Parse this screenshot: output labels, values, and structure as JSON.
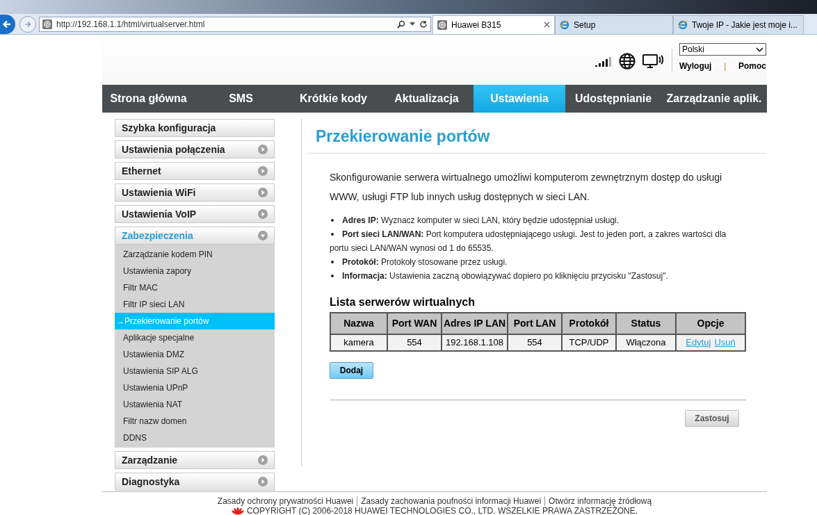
{
  "browser": {
    "address": "http://192.168.1.1/html/virtualserver.html",
    "tabs": [
      {
        "label": "Huawei B315",
        "selected": true,
        "kind": "site"
      },
      {
        "label": "Setup",
        "selected": false,
        "kind": "ie"
      },
      {
        "label": "Twoje IP - Jakie jest moje i...",
        "selected": false,
        "kind": "ie"
      }
    ]
  },
  "header": {
    "language": "Polski",
    "logout": "Wyloguj",
    "separator": "|",
    "help": "Pomoc"
  },
  "nav": [
    {
      "label": "Strona główna",
      "selected": false
    },
    {
      "label": "SMS",
      "selected": false
    },
    {
      "label": "Krótkie kody",
      "selected": false
    },
    {
      "label": "Aktualizacja",
      "selected": false
    },
    {
      "label": "Ustawienia",
      "selected": true
    },
    {
      "label": "Udostępnianie",
      "selected": false
    },
    {
      "label": "Zarządzanie aplik.",
      "selected": false
    }
  ],
  "sidebar": [
    {
      "label": "Szybka konfiguracja",
      "kind": "link",
      "expanded": false
    },
    {
      "label": "Ustawienia połączenia",
      "kind": "group",
      "expanded": false
    },
    {
      "label": "Ethernet",
      "kind": "group",
      "expanded": false
    },
    {
      "label": "Ustawienia WiFi",
      "kind": "group",
      "expanded": false
    },
    {
      "label": "Ustawienia VoIP",
      "kind": "group",
      "expanded": false
    },
    {
      "label": "Zabezpieczenia",
      "kind": "group",
      "expanded": true,
      "children": [
        {
          "label": "Zarządzanie kodem PIN",
          "selected": false
        },
        {
          "label": "Ustawienia zapory",
          "selected": false
        },
        {
          "label": "Filtr MAC",
          "selected": false
        },
        {
          "label": "Filtr IP sieci LAN",
          "selected": false
        },
        {
          "label": "Przekierowanie portów",
          "selected": true,
          "marker": "→"
        },
        {
          "label": "Aplikacje specjalne",
          "selected": false
        },
        {
          "label": "Ustawienia DMZ",
          "selected": false
        },
        {
          "label": "Ustawienia SIP ALG",
          "selected": false
        },
        {
          "label": "Ustawienia UPnP",
          "selected": false
        },
        {
          "label": "Ustawienia NAT",
          "selected": false
        },
        {
          "label": "Filtr nazw domen",
          "selected": false
        },
        {
          "label": "DDNS",
          "selected": false
        }
      ]
    },
    {
      "label": "Zarządzanie",
      "kind": "group",
      "expanded": false
    },
    {
      "label": "Diagnostyka",
      "kind": "group",
      "expanded": false
    }
  ],
  "content": {
    "title": "Przekierowanie portów",
    "intro": "Skonfigurowanie serwera wirtualnego umożliwi komputerom zewnętrznym dostęp do usługi WWW, usługi FTP lub innych usług dostępnych w sieci LAN.",
    "bullets": [
      "**Adres IP:** Wyznacz komputer w sieci LAN, który będzie udostępniał usługi.",
      "**Port sieci LAN/WAN:** Port komputera udostępniającego usługi. Jest to jeden port, a zakres wartości dla portu sieci LAN/WAN wynosi od 1 do 65535.",
      "**Protokół:** Protokoły stosowane przez usługi.",
      "**Informacja:** Ustawienia zaczną obowiązywać dopiero po kliknięciu przycisku \"Zastosuj\"."
    ],
    "table": {
      "title": "Lista serwerów wirtualnych",
      "columns": [
        "Nazwa",
        "Port WAN",
        "Adres IP LAN",
        "Port LAN",
        "Protokół",
        "Status",
        "Opcje"
      ],
      "rows": [
        {
          "cells": [
            "kamera",
            "554",
            "192.168.1.108",
            "554",
            "TCP/UDP",
            "Włączona"
          ],
          "actions": [
            "Edytuj",
            "Usuń"
          ]
        }
      ]
    },
    "add_button": "Dodaj",
    "apply_button": "Zastosuj"
  },
  "footer": {
    "links": [
      "Zasady ochrony prywatności Huawei",
      "Zasady zachowania poufności informacji Huawei",
      "Otwórz informację źródłową"
    ],
    "copyright": "COPYRIGHT (C) 2006-2018 HUAWEI TECHNOLOGIES CO., LTD. WSZELKIE PRAWA ZASTRZEŻONE."
  }
}
